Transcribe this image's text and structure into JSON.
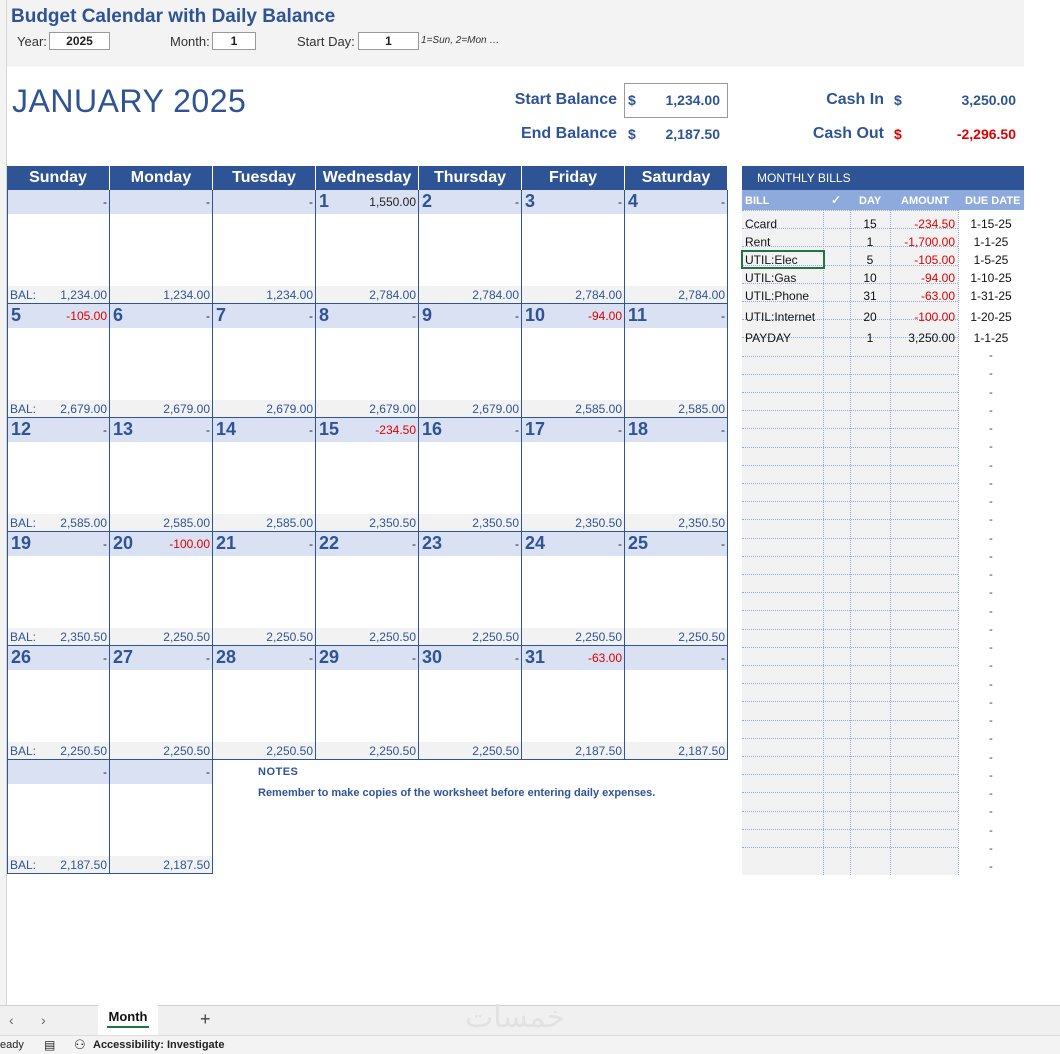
{
  "app_title": "Budget Calendar with Daily Balance",
  "controls": {
    "year_label": "Year:",
    "year_value": "2025",
    "month_label": "Month:",
    "month_value": "1",
    "startday_label": "Start Day:",
    "startday_value": "1",
    "startday_hint": "1=Sun, 2=Mon …"
  },
  "month_title": "JANUARY 2025",
  "summary": {
    "start_balance_label": "Start Balance",
    "start_balance": "1,234.00",
    "end_balance_label": "End Balance",
    "end_balance": "2,187.50",
    "cash_in_label": "Cash In",
    "cash_in": "3,250.00",
    "cash_out_label": "Cash Out",
    "cash_out": "-2,296.50",
    "currency": "$"
  },
  "weekdays": [
    "Sunday",
    "Monday",
    "Tuesday",
    "Wednesday",
    "Thursday",
    "Friday",
    "Saturday"
  ],
  "bal_label": "BAL:",
  "weeks": [
    [
      {
        "day": "",
        "amount": "-",
        "bal": "1,234.00",
        "showLbl": true
      },
      {
        "day": "",
        "amount": "-",
        "bal": "1,234.00"
      },
      {
        "day": "",
        "amount": "-",
        "bal": "1,234.00"
      },
      {
        "day": "1",
        "amount": "1,550.00",
        "bal": "2,784.00"
      },
      {
        "day": "2",
        "amount": "-",
        "bal": "2,784.00"
      },
      {
        "day": "3",
        "amount": "-",
        "bal": "2,784.00"
      },
      {
        "day": "4",
        "amount": "-",
        "bal": "2,784.00"
      }
    ],
    [
      {
        "day": "5",
        "amount": "-105.00",
        "neg": true,
        "bal": "2,679.00",
        "showLbl": true
      },
      {
        "day": "6",
        "amount": "-",
        "bal": "2,679.00"
      },
      {
        "day": "7",
        "amount": "-",
        "bal": "2,679.00"
      },
      {
        "day": "8",
        "amount": "-",
        "bal": "2,679.00"
      },
      {
        "day": "9",
        "amount": "-",
        "bal": "2,679.00"
      },
      {
        "day": "10",
        "amount": "-94.00",
        "neg": true,
        "bal": "2,585.00"
      },
      {
        "day": "11",
        "amount": "-",
        "bal": "2,585.00"
      }
    ],
    [
      {
        "day": "12",
        "amount": "-",
        "bal": "2,585.00",
        "showLbl": true
      },
      {
        "day": "13",
        "amount": "-",
        "bal": "2,585.00"
      },
      {
        "day": "14",
        "amount": "-",
        "bal": "2,585.00"
      },
      {
        "day": "15",
        "amount": "-234.50",
        "neg": true,
        "bal": "2,350.50"
      },
      {
        "day": "16",
        "amount": "-",
        "bal": "2,350.50"
      },
      {
        "day": "17",
        "amount": "-",
        "bal": "2,350.50"
      },
      {
        "day": "18",
        "amount": "-",
        "bal": "2,350.50"
      }
    ],
    [
      {
        "day": "19",
        "amount": "-",
        "bal": "2,350.50",
        "showLbl": true
      },
      {
        "day": "20",
        "amount": "-100.00",
        "neg": true,
        "bal": "2,250.50"
      },
      {
        "day": "21",
        "amount": "-",
        "bal": "2,250.50"
      },
      {
        "day": "22",
        "amount": "-",
        "bal": "2,250.50"
      },
      {
        "day": "23",
        "amount": "-",
        "bal": "2,250.50"
      },
      {
        "day": "24",
        "amount": "-",
        "bal": "2,250.50"
      },
      {
        "day": "25",
        "amount": "-",
        "bal": "2,250.50"
      }
    ],
    [
      {
        "day": "26",
        "amount": "-",
        "bal": "2,250.50",
        "showLbl": true
      },
      {
        "day": "27",
        "amount": "-",
        "bal": "2,250.50"
      },
      {
        "day": "28",
        "amount": "-",
        "bal": "2,250.50"
      },
      {
        "day": "29",
        "amount": "-",
        "bal": "2,250.50"
      },
      {
        "day": "30",
        "amount": "-",
        "bal": "2,250.50"
      },
      {
        "day": "31",
        "amount": "-63.00",
        "neg": true,
        "bal": "2,187.50"
      },
      {
        "day": "",
        "amount": "-",
        "bal": "2,187.50"
      }
    ],
    [
      {
        "day": "",
        "amount": "-",
        "bal": "2,187.50",
        "showLbl": true
      },
      {
        "day": "",
        "amount": "-",
        "bal": "2,187.50"
      }
    ]
  ],
  "notes": {
    "title": "NOTES",
    "text": "Remember to make copies of the worksheet before entering daily expenses."
  },
  "bills": {
    "title": "MONTHLY BILLS",
    "headers": {
      "bill": "BILL",
      "check": "✓",
      "day": "DAY",
      "amount": "AMOUNT",
      "due": "DUE DATE"
    },
    "rows": [
      {
        "name": "Ccard",
        "day": "15",
        "amount": "-234.50",
        "neg": true,
        "due": "1-15-25"
      },
      {
        "name": "Rent",
        "day": "1",
        "amount": "-1,700.00",
        "neg": true,
        "due": "1-1-25"
      },
      {
        "name": "UTIL:Elec",
        "day": "5",
        "amount": "-105.00",
        "neg": true,
        "due": "1-5-25"
      },
      {
        "name": "UTIL:Gas",
        "day": "10",
        "amount": "-94.00",
        "neg": true,
        "due": "1-10-25"
      },
      {
        "name": "UTIL:Phone",
        "day": "31",
        "amount": "-63.00",
        "neg": true,
        "due": "1-31-25"
      },
      {
        "name": "UTIL:Internet",
        "day": "20",
        "amount": "-100.00",
        "neg": true,
        "due": "1-20-25"
      },
      {
        "name": "PAYDAY",
        "day": "1",
        "amount": "3,250.00",
        "neg": false,
        "due": "1-1-25"
      }
    ],
    "empty_due": "-"
  },
  "sheet_tab": "Month",
  "add_sheet": "+",
  "nav_prev": "‹",
  "nav_next": "›",
  "status": {
    "ready": "eady",
    "accessibility": "Accessibility: Investigate"
  },
  "watermark": "خمسات",
  "colors": {
    "accent": "#2f5496",
    "header_light": "#8ea9db",
    "row_light": "#d9e1f2",
    "negative": "#e00000",
    "selection": "#217346"
  }
}
